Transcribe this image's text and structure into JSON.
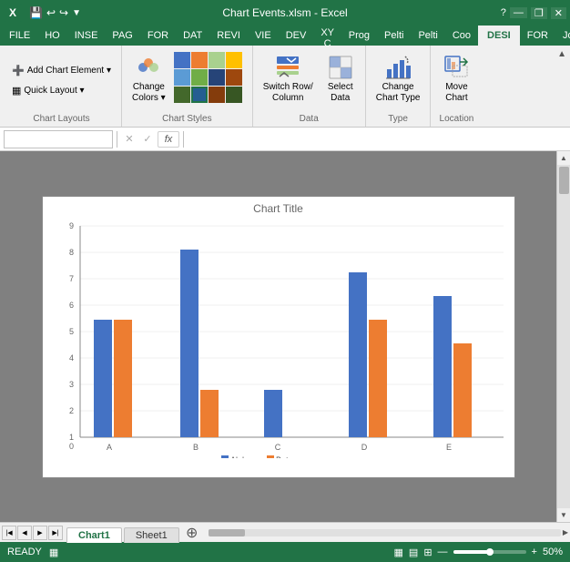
{
  "titleBar": {
    "appIcon": "X",
    "icons": [
      "💾",
      "↩",
      "↪",
      "▶"
    ],
    "title": "Chart Events.xlsm - Excel",
    "controls": [
      "?",
      "⬛",
      "❐",
      "✕"
    ]
  },
  "ribbonTabs": [
    {
      "id": "file",
      "label": "FILE",
      "active": false
    },
    {
      "id": "ho",
      "label": "HO",
      "active": false
    },
    {
      "id": "inse",
      "label": "INSE",
      "active": false
    },
    {
      "id": "page",
      "label": "PAG",
      "active": false
    },
    {
      "id": "for",
      "label": "FOR",
      "active": false
    },
    {
      "id": "dat",
      "label": "DAT",
      "active": false
    },
    {
      "id": "revi",
      "label": "REVI",
      "active": false
    },
    {
      "id": "vie",
      "label": "VIE",
      "active": false
    },
    {
      "id": "dev",
      "label": "DEV",
      "active": false
    },
    {
      "id": "xyc",
      "label": "XY C",
      "active": false
    },
    {
      "id": "prog",
      "label": "Prog",
      "active": false
    },
    {
      "id": "pelti1",
      "label": "Pelti",
      "active": false
    },
    {
      "id": "pelti2",
      "label": "Pelti",
      "active": false
    },
    {
      "id": "coo",
      "label": "Coo",
      "active": false
    },
    {
      "id": "desi",
      "label": "DESI",
      "active": true
    },
    {
      "id": "format",
      "label": "FOR",
      "active": false
    },
    {
      "id": "jo",
      "label": "Jo",
      "active": false
    }
  ],
  "ribbon": {
    "sections": [
      {
        "id": "chart-layouts",
        "label": "Chart Layouts",
        "buttons": [
          {
            "id": "add-chart-element",
            "label": "Add Chart Element ▾",
            "small": true
          },
          {
            "id": "quick-layout",
            "label": "Quick Layout ▾",
            "small": true
          }
        ]
      },
      {
        "id": "chart-styles",
        "label": "Chart Styles",
        "buttons": [
          {
            "id": "change-colors",
            "label": "Change\nColors ▾",
            "big": true
          },
          {
            "id": "quick-styles",
            "label": "Quick\nStyles ▾",
            "big": true
          }
        ]
      },
      {
        "id": "data",
        "label": "Data",
        "buttons": [
          {
            "id": "switch-row-col",
            "label": "Switch Row/\nColumn",
            "big": true
          },
          {
            "id": "select-data",
            "label": "Select\nData",
            "big": true
          }
        ]
      },
      {
        "id": "type",
        "label": "Type",
        "buttons": [
          {
            "id": "change-chart-type",
            "label": "Change\nChart Type",
            "big": true
          }
        ]
      },
      {
        "id": "location",
        "label": "Location",
        "buttons": [
          {
            "id": "move-chart",
            "label": "Move\nChart",
            "big": true
          }
        ]
      }
    ]
  },
  "formulaBar": {
    "nameBox": "",
    "cancelBtn": "✕",
    "confirmBtn": "✓",
    "functionBtn": "fx",
    "formula": ""
  },
  "chart": {
    "title": "Chart Title",
    "yMax": 9,
    "yMin": 0,
    "categories": [
      "A",
      "B",
      "C",
      "D",
      "E"
    ],
    "series": [
      {
        "name": "Alpha",
        "color": "#4472C4",
        "values": [
          5,
          8,
          2,
          7,
          6
        ]
      },
      {
        "name": "Beta",
        "color": "#ED7D31",
        "values": [
          5,
          2,
          0,
          5,
          4
        ]
      }
    ]
  },
  "sheetTabs": [
    {
      "id": "chart1",
      "label": "Chart1",
      "active": true
    },
    {
      "id": "sheet1",
      "label": "Sheet1",
      "active": false
    }
  ],
  "statusBar": {
    "status": "READY",
    "zoom": "50%"
  }
}
